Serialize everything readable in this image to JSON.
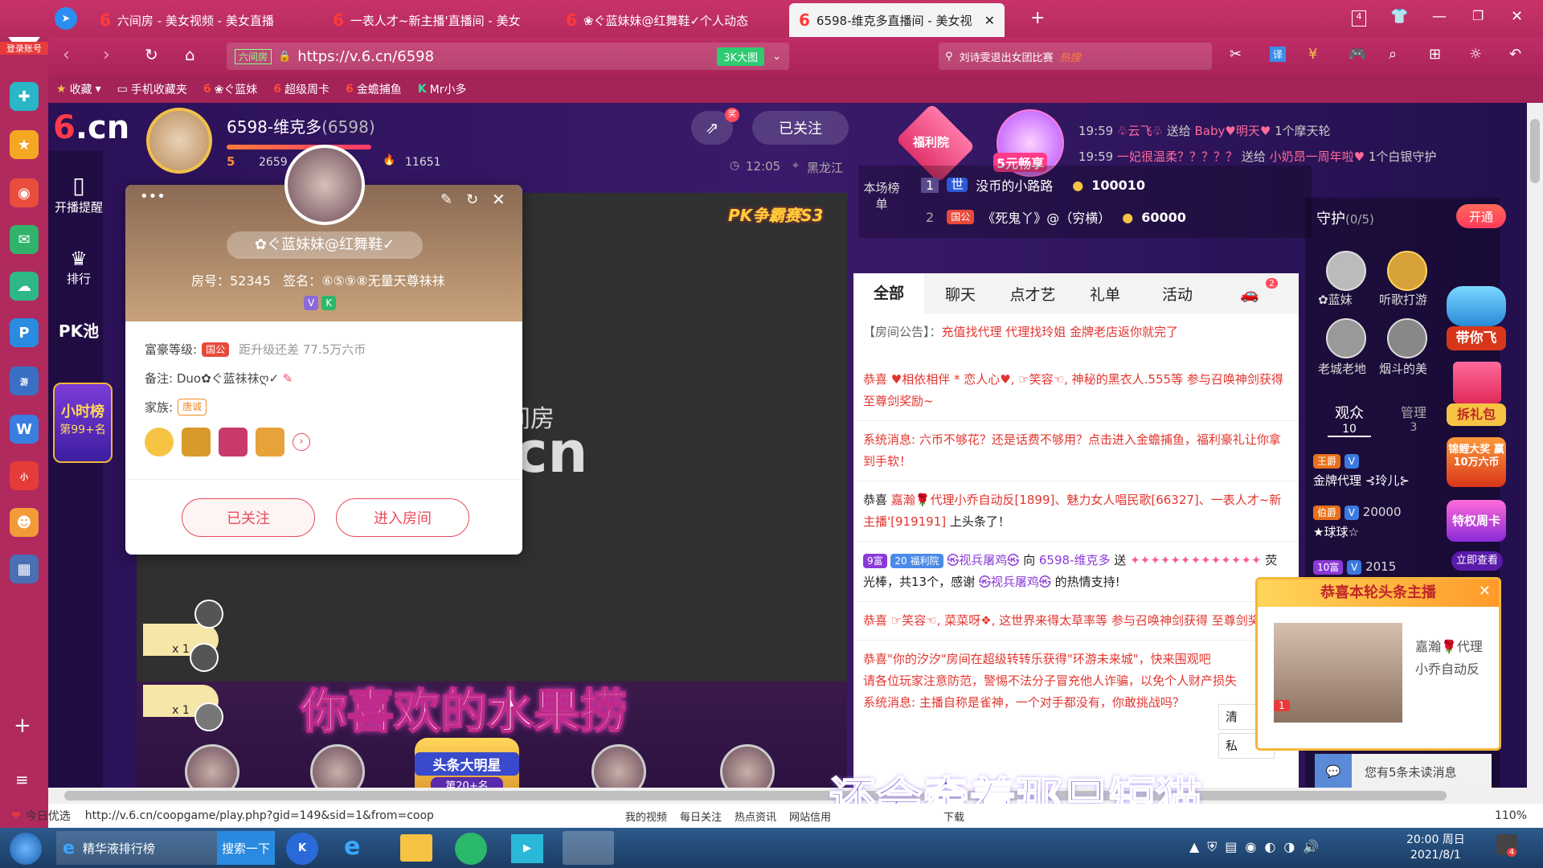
{
  "browser": {
    "tabs": [
      {
        "title": "六间房 - 美女视频 - 美女直播"
      },
      {
        "title": "一表人才~新主播'直播间 - 美女"
      },
      {
        "title": "❀ぐ蓝妹妹@红舞鞋✓个人动态"
      },
      {
        "title": "6598-维克多直播间 - 美女视"
      }
    ],
    "tab_count": "4",
    "url": "https://v.6.cn/6598",
    "url_prefix": "六间房",
    "bigscreen_label": "3K大图",
    "search_text": "刘诗雯退出女团比赛",
    "search_hot": "热搜",
    "translate_label": "译",
    "login_label": "登录账号",
    "bookmarks": [
      "收藏",
      "手机收藏夹",
      "❀ぐ蓝妹",
      "超级周卡",
      "金蟾捕鱼",
      "Mr小多"
    ]
  },
  "status": {
    "today": "今日优选",
    "link_url": "http://v.6.cn/coopgame/play.php?gid=149&sid=1&from=coop",
    "items": [
      "我的视频",
      "每日关注",
      "热点资讯",
      "网站信用",
      "下载"
    ],
    "zoom": "110%"
  },
  "taskbar": {
    "app_title": "精华液排行榜",
    "search_btn": "搜索一下",
    "time": "20:00 周日",
    "date": "2021/8/1",
    "notify": "4"
  },
  "anchor": {
    "name": "6598-维克多",
    "room_id": "(6598)",
    "level": "5",
    "fans": "2659",
    "heat": "11651",
    "time": "12:05",
    "region": "黑龙江",
    "follow_label": "已关注",
    "share_badge": "奖"
  },
  "left_nav": [
    {
      "label": "开播提醒"
    },
    {
      "label": "排行"
    },
    {
      "label": "PK池"
    }
  ],
  "hour_rank": {
    "title": "小时榜",
    "rank": "第99+名"
  },
  "popup": {
    "name": "✿ぐ蓝妹妹@红舞鞋✓",
    "room_no_label": "房号：52345",
    "sign_label": "签名：",
    "sign": "⑥⑤⑨⑧无量天尊祙祙",
    "wealth_label": "富豪等级:",
    "wealth_badge": "国公",
    "wealth_gap": "距升级还差 77.5万六币",
    "remark_label": "备注:",
    "remark": "Duo✿ぐ蓝祙祙ღ✓",
    "family_label": "家族:",
    "family_badge": "唐诚",
    "follow_btn": "已关注",
    "enter_btn": "进入房间",
    "vbadge": "V",
    "kbadge": "K"
  },
  "video": {
    "pk_badge": "PK争霸赛S3",
    "banner": "你喜欢的水果捞",
    "logo_text": "六间房",
    "star_title": "头条大明星",
    "star_rank": "第20+名",
    "x1a": "x 1",
    "x1b": "x 1"
  },
  "subtitle": "还会牵着那只短猫",
  "gift_feed": [
    {
      "time": "19:59",
      "user": "♧云飞♧",
      "verb": "送给",
      "target": "Baby♥明天♥",
      "gift": "1个摩天轮"
    },
    {
      "time": "19:59",
      "user": "一妃很温柔？？？？？",
      "verb": "送给",
      "target": "小奶昂一周年啦♥",
      "gift": "1个白银守护"
    }
  ],
  "promo": {
    "welfare": "福利院",
    "five": "5元畅享"
  },
  "rank_board": {
    "label": "本场榜单",
    "rows": [
      {
        "rank": "1",
        "badge": "世",
        "name": "没币的小路路",
        "score": "100010"
      },
      {
        "rank": "2",
        "badge": "国公",
        "name": "《死鬼丫》@（穷横）",
        "score": "60000"
      }
    ]
  },
  "chat_tabs": [
    "全部",
    "聊天",
    "点才艺",
    "礼单",
    "活动"
  ],
  "car_badge": "2",
  "chat": {
    "notice_label": "【房间公告】：",
    "notice": "充值找代理 代理找玲姐 金牌老店返你就完了",
    "m1": "恭喜 ♥相依相伴 * 恋人心♥, ☞笑容☜, 神秘的黑衣人.555等 参与召唤神剑获得 至尊剑奖励~",
    "m2": "系统消息: 六币不够花？还是话费不够用？点击进入金蟾捕鱼，福利豪礼让你拿到手软！",
    "m3_pre": "恭喜 ",
    "m3_red": "嘉瀚🌹代理小乔自动反[1899]、魅力女人唱民歌[66327]、一表人才~新主播'[919191]",
    "m3_post": " 上头条了！",
    "m4_badge1": "9富",
    "m4_badge2": "20 福利院",
    "m4_user": "㉿视兵屠鸡㉿",
    "m4_mid": "向",
    "m4_target": "6598-维克多",
    "m4_send": "送",
    "m4_tail": "荧光棒，共13个，感谢",
    "m4_user2": "㉿视兵屠鸡㉿",
    "m4_end": "的热情支持!",
    "m5": "恭喜 ☞笑容☜, 菜菜呀❖, 这世界来得太草率等 参与召唤神剑获得 至尊剑奖励~",
    "m6": "恭喜\"你的汐汐\"房间在超级转转乐获得\"环游未来城\"，快来围观吧",
    "m7": "请各位玩家注意防范，警惕不法分子冒充他人诈骗，以免个人财产损失",
    "m8": "系统消息: 主播自称是雀神，一个对手都没有，你敢挑战吗？",
    "clear": "清",
    "private": "私"
  },
  "guard": {
    "title": "守护",
    "count": "(0/5)",
    "open_btn": "开通",
    "members": [
      {
        "name": "✿蓝妹"
      },
      {
        "name": "听歌打游"
      },
      {
        "name": "老城老地"
      },
      {
        "name": "烟斗的美"
      }
    ],
    "tabs": [
      {
        "label": "观众",
        "count": "10"
      },
      {
        "label": "管理",
        "count": "3"
      }
    ],
    "viewers": [
      {
        "badge": "王爵",
        "name": "金牌代理 ⊰玲儿⊱",
        "score": ""
      },
      {
        "badge": "伯爵",
        "name": "★球球☆",
        "score": "20000"
      },
      {
        "badge": "10富",
        "name": "",
        "score": "2015"
      }
    ],
    "promos": [
      "带你飞",
      "拆礼包",
      "锦鲤大奖 赢10万六币",
      "特权周卡",
      "立即查看"
    ]
  },
  "headline_popup": {
    "title": "恭喜本轮头条主播",
    "name": "嘉瀚🌹代理小乔自动反",
    "rank": "1"
  },
  "unread": "您有5条未读消息"
}
